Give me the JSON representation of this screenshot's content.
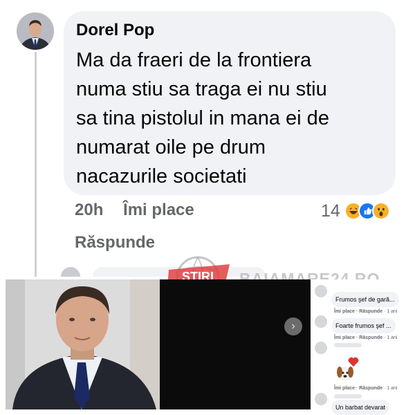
{
  "comment": {
    "author": "Dorel Pop",
    "text": "Ma da fraeri de la frontiera\nnuma stiu sa traga ei nu stiu\nsa tina pistolul in mana ei de\nnumarat  oile pe drum\nnacazurile societati",
    "time": "20h",
    "like_label": "Îmi place",
    "reply_label": "Răspunde",
    "reaction_count": "14",
    "reactions": [
      "haha",
      "like",
      "wow"
    ]
  },
  "watermark": {
    "logo_text": "STIRI",
    "site": "BAIAMARE24.RO"
  },
  "video": {
    "next_icon": "›"
  },
  "side_comments": [
    {
      "text": "Frumos şef de gară...",
      "like": "Îmi place",
      "sep": "·",
      "reply": "Răspunde",
      "age": "· 1 ani"
    },
    {
      "text": "Foarte frumos şef ...",
      "like": "Îmi place",
      "sep": "·",
      "reply": "Răspunde",
      "age": "· 1 ani"
    },
    {
      "text": "",
      "like": "",
      "sep": "",
      "reply": "",
      "age": ""
    },
    {
      "text": "",
      "like": "Îmi place",
      "sep": "·",
      "reply": "Răspunde",
      "age": "· 1 ani"
    },
    {
      "text": "Un barbat devarat",
      "like": "",
      "sep": "",
      "reply": "",
      "age": ""
    }
  ],
  "colors": {
    "bubble": "#f0f2f5",
    "meta": "#65676b",
    "like_blue": "#1877f2",
    "haha_yellow": "#f7b125",
    "watermark_red": "#e23b3b"
  }
}
